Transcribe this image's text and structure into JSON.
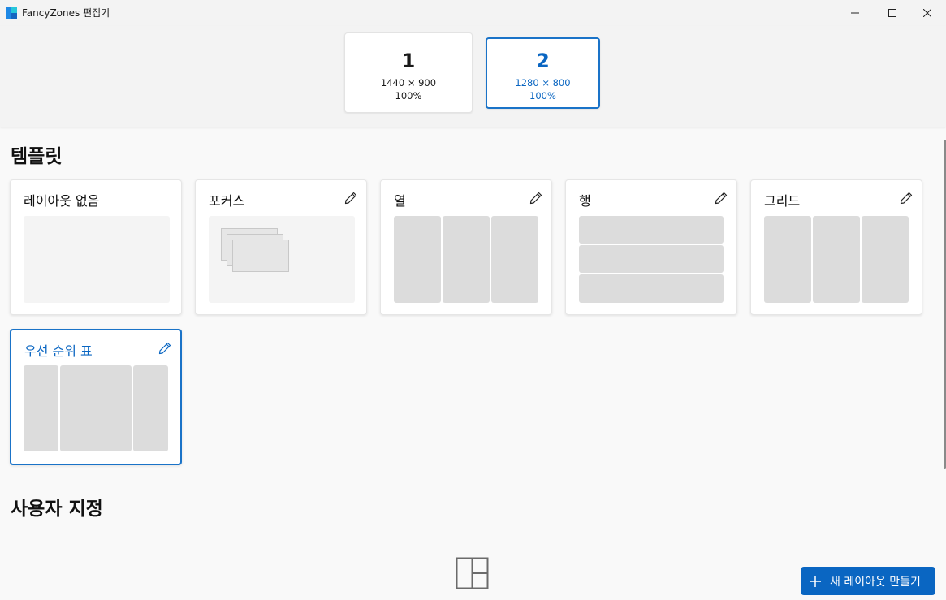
{
  "window": {
    "title": "FancyZones 편집기",
    "controls": [
      "minimize",
      "maximize",
      "close"
    ]
  },
  "monitors": [
    {
      "number": "1",
      "resolution": "1440 × 900",
      "scale": "100%",
      "selected": false
    },
    {
      "number": "2",
      "resolution": "1280 × 800",
      "scale": "100%",
      "selected": true
    }
  ],
  "sections": {
    "templates": "템플릿",
    "custom": "사용자 지정"
  },
  "templates": [
    {
      "name": "레이아웃 없음",
      "layout": "blank",
      "editable": false,
      "selected": false
    },
    {
      "name": "포커스",
      "layout": "focus",
      "editable": true,
      "selected": false
    },
    {
      "name": "열",
      "layout": "columns",
      "editable": true,
      "selected": false
    },
    {
      "name": "행",
      "layout": "rows",
      "editable": true,
      "selected": false
    },
    {
      "name": "그리드",
      "layout": "grid",
      "editable": true,
      "selected": false
    },
    {
      "name": "우선 순위 표",
      "layout": "priority-grid",
      "editable": true,
      "selected": true
    }
  ],
  "new_layout_button": "새 레이아웃 만들기",
  "colors": {
    "accent": "#0a66c2",
    "zone": "#dcdcdc",
    "background": "#f9f9f9"
  }
}
